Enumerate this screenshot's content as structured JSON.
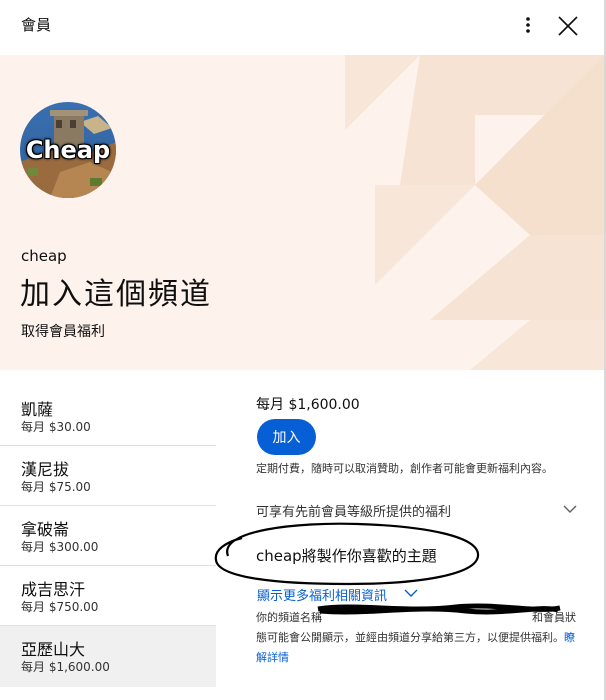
{
  "header": {
    "title": "會員",
    "more_icon": "more-vert-icon",
    "close_icon": "close-icon"
  },
  "hero": {
    "avatar_text": "Cheap",
    "channel_name": "cheap",
    "title": "加入這個頻道",
    "subtitle": "取得會員福利",
    "background_color": "#fdf2ec"
  },
  "tiers": [
    {
      "name": "凱薩",
      "price": "每月 $30.00",
      "selected": false
    },
    {
      "name": "漢尼拔",
      "price": "每月 $75.00",
      "selected": false
    },
    {
      "name": "拿破崙",
      "price": "每月 $300.00",
      "selected": false
    },
    {
      "name": "成吉思汗",
      "price": "每月 $750.00",
      "selected": false
    },
    {
      "name": "亞歷山大",
      "price": "每月 $1,600.00",
      "selected": true
    }
  ],
  "detail": {
    "price": "每月 $1,600.00",
    "join_label": "加入",
    "billing_note": "定期付費，隨時可以取消贊助，創作者可能會更新福利內容。",
    "perks_label": "可享有先前會員等級所提供的福利",
    "perk_item": "cheap將製作你喜歡的主題",
    "more_info_label": "顯示更多福利相關資訊",
    "privacy_part1": "你的頻道名稱",
    "privacy_part2": "和會員狀態可能會公開顯示，並經由頻道分享給第三方，以便提供福利。",
    "learn_more": "瞭解詳情",
    "accent_color": "#065fd4"
  }
}
